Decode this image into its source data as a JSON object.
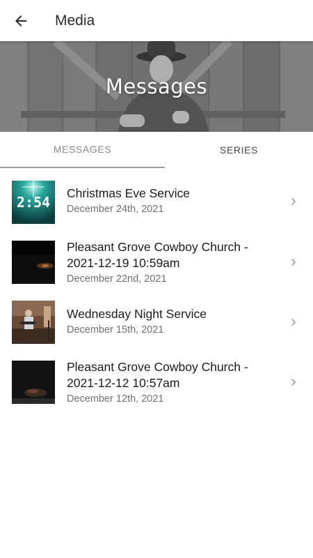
{
  "appbar": {
    "back_icon": "arrow-back-icon",
    "title": "Media"
  },
  "hero": {
    "title": "Messages"
  },
  "tabs": [
    {
      "label": "MESSAGES",
      "selected": true
    },
    {
      "label": "SERIES",
      "selected": false
    }
  ],
  "messages": [
    {
      "title": "Christmas Eve Service",
      "date": "December 24th, 2021",
      "thumb_text": "2:54"
    },
    {
      "title": "Pleasant Grove Cowboy Church - 2021-12-19 10:59am",
      "date": "December 22nd, 2021"
    },
    {
      "title": "Wednesday Night Service",
      "date": "December 15th, 2021"
    },
    {
      "title": "Pleasant Grove Cowboy Church - 2021-12-12 10:57am",
      "date": "December 12th, 2021"
    }
  ],
  "colors": {
    "accent": "#9e9e9e",
    "text_primary": "#1c1c1c",
    "text_secondary": "#707070"
  }
}
